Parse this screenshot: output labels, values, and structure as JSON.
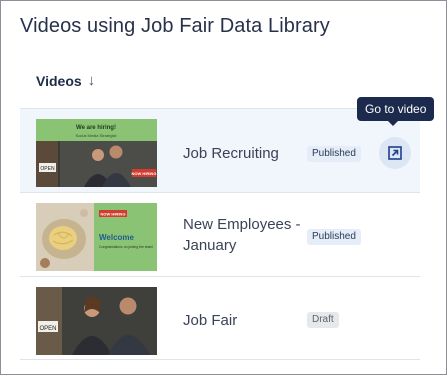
{
  "panel": {
    "title": "Videos using Job Fair Data Library"
  },
  "table": {
    "column_header": "Videos",
    "sort_icon": "arrow-down-icon"
  },
  "tooltip": {
    "label": "Go to video"
  },
  "rows": [
    {
      "title": "Job Recruiting",
      "status": "Published",
      "thumbnail": {
        "banner_heading": "We are hiring!",
        "banner_sub": "Social Media Strategist",
        "sign_open": "OPEN",
        "sign_red": "NOW HIRING"
      }
    },
    {
      "title": "New Employees - January",
      "status": "Published",
      "thumbnail": {
        "tag": "NOW HIRING",
        "heading": "Welcome",
        "sub": "Congratulations on joining the team!"
      }
    },
    {
      "title": "Job Fair",
      "status": "Draft",
      "thumbnail": {
        "sign_open": "OPEN"
      }
    }
  ],
  "colors": {
    "accent": "#1c2b4d",
    "row_hover": "#f1f5fc",
    "badge_published": "#e4edf8",
    "badge_draft": "#e7e8ea",
    "thumb_green": "#8bc374"
  }
}
